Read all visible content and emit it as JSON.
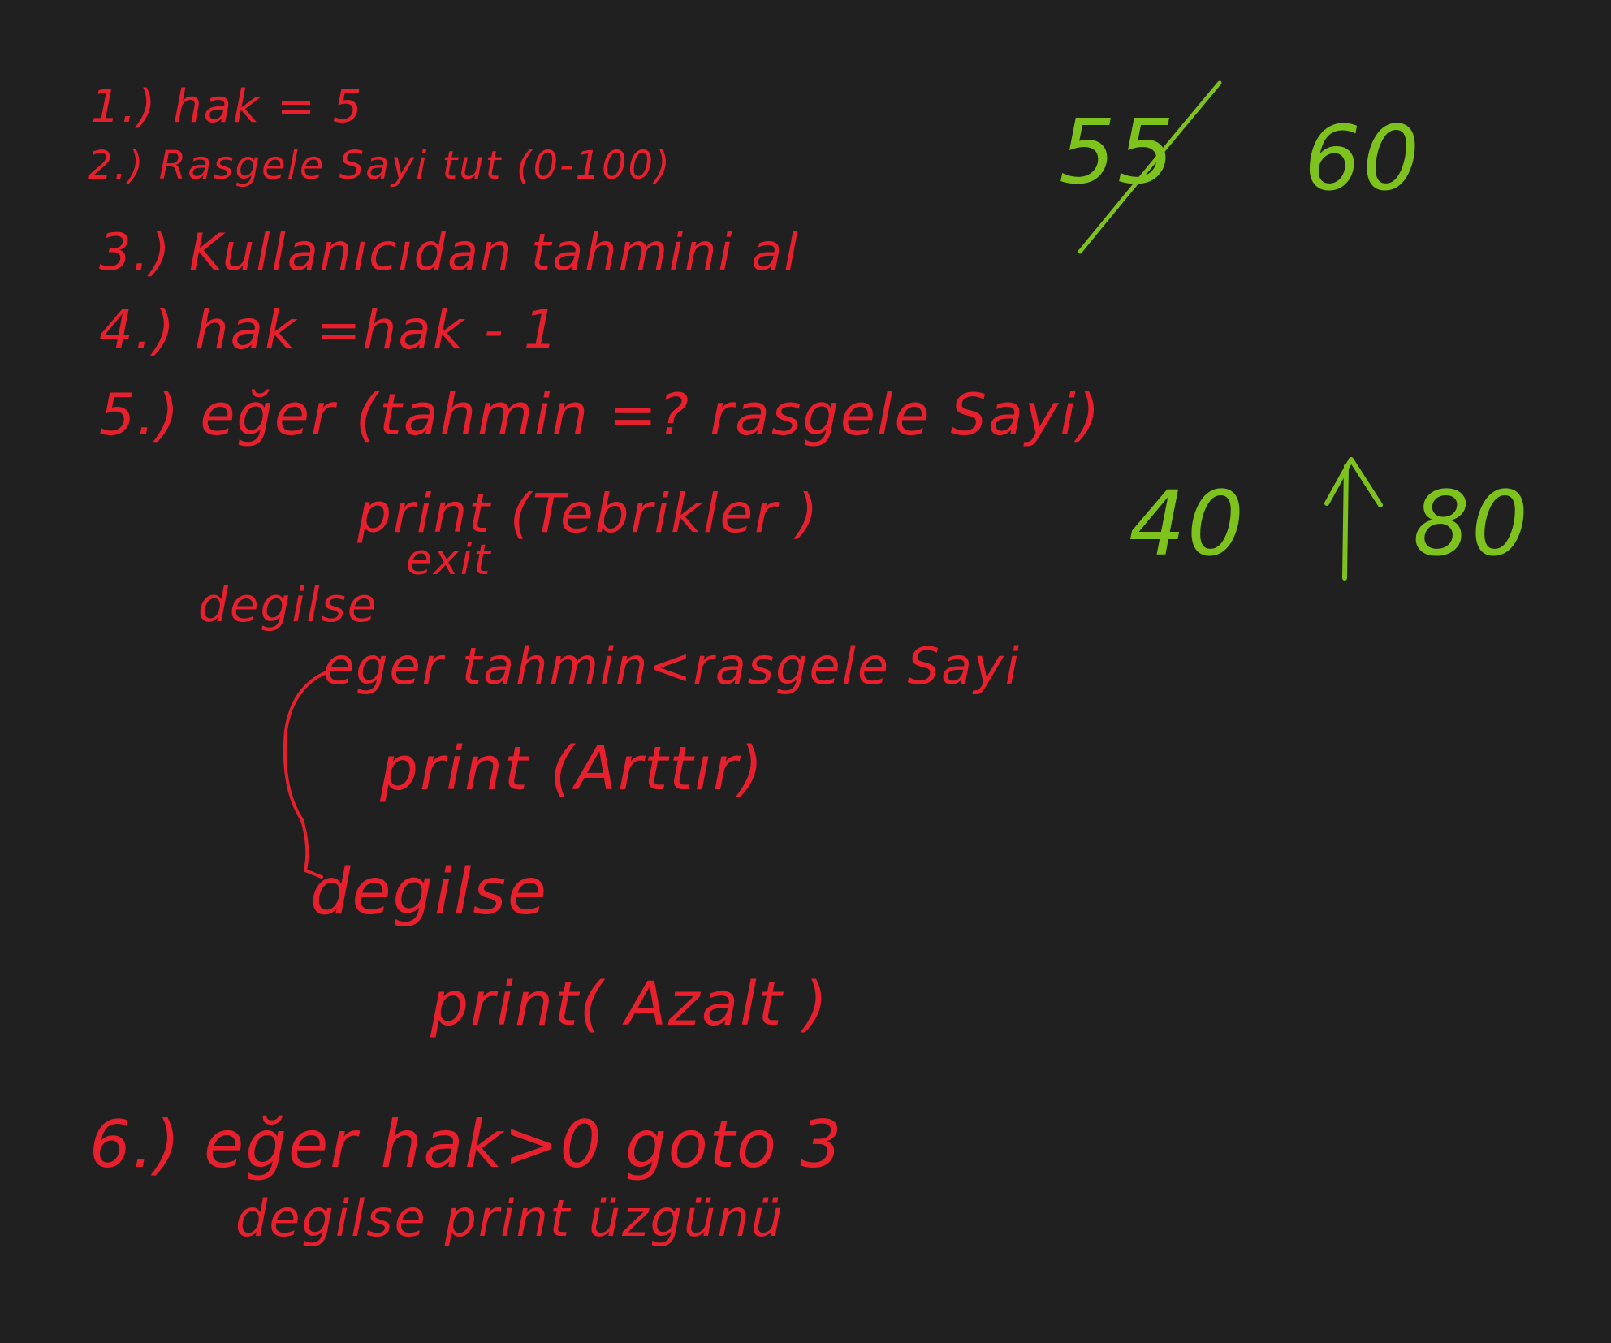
{
  "canvas": {
    "background": "#202020",
    "ink_red": "#e8202e",
    "ink_green": "#7ec21e"
  },
  "algorithm": {
    "step_1": "1.) hak = 5",
    "step_2": "2.) Rasgele Sayi tut (0-100)",
    "step_3": "3.) Kullanıcıdan tahmini al",
    "step_4": "4.) hak =hak - 1",
    "step_5": "5.) eğer (tahmin =? rasgele Sayi)",
    "print_tebrik": "print (Tebrikler )",
    "exit": "exit",
    "degilse_1": "degilse",
    "nested_if": "eger tahmin<rasgele Sayi",
    "print_arttir": "print (Arttır)",
    "degilse_2": "degilse",
    "print_azalt": "print( Azalt )",
    "step_6": "6.) eğer hak>0 goto 3",
    "else_final": "degilse print üzgünü"
  },
  "notes": {
    "crossed_number": "5",
    "n_60": "60",
    "n_40": "40",
    "arrow_icon": "up-arrow-icon",
    "n_80": "80"
  }
}
